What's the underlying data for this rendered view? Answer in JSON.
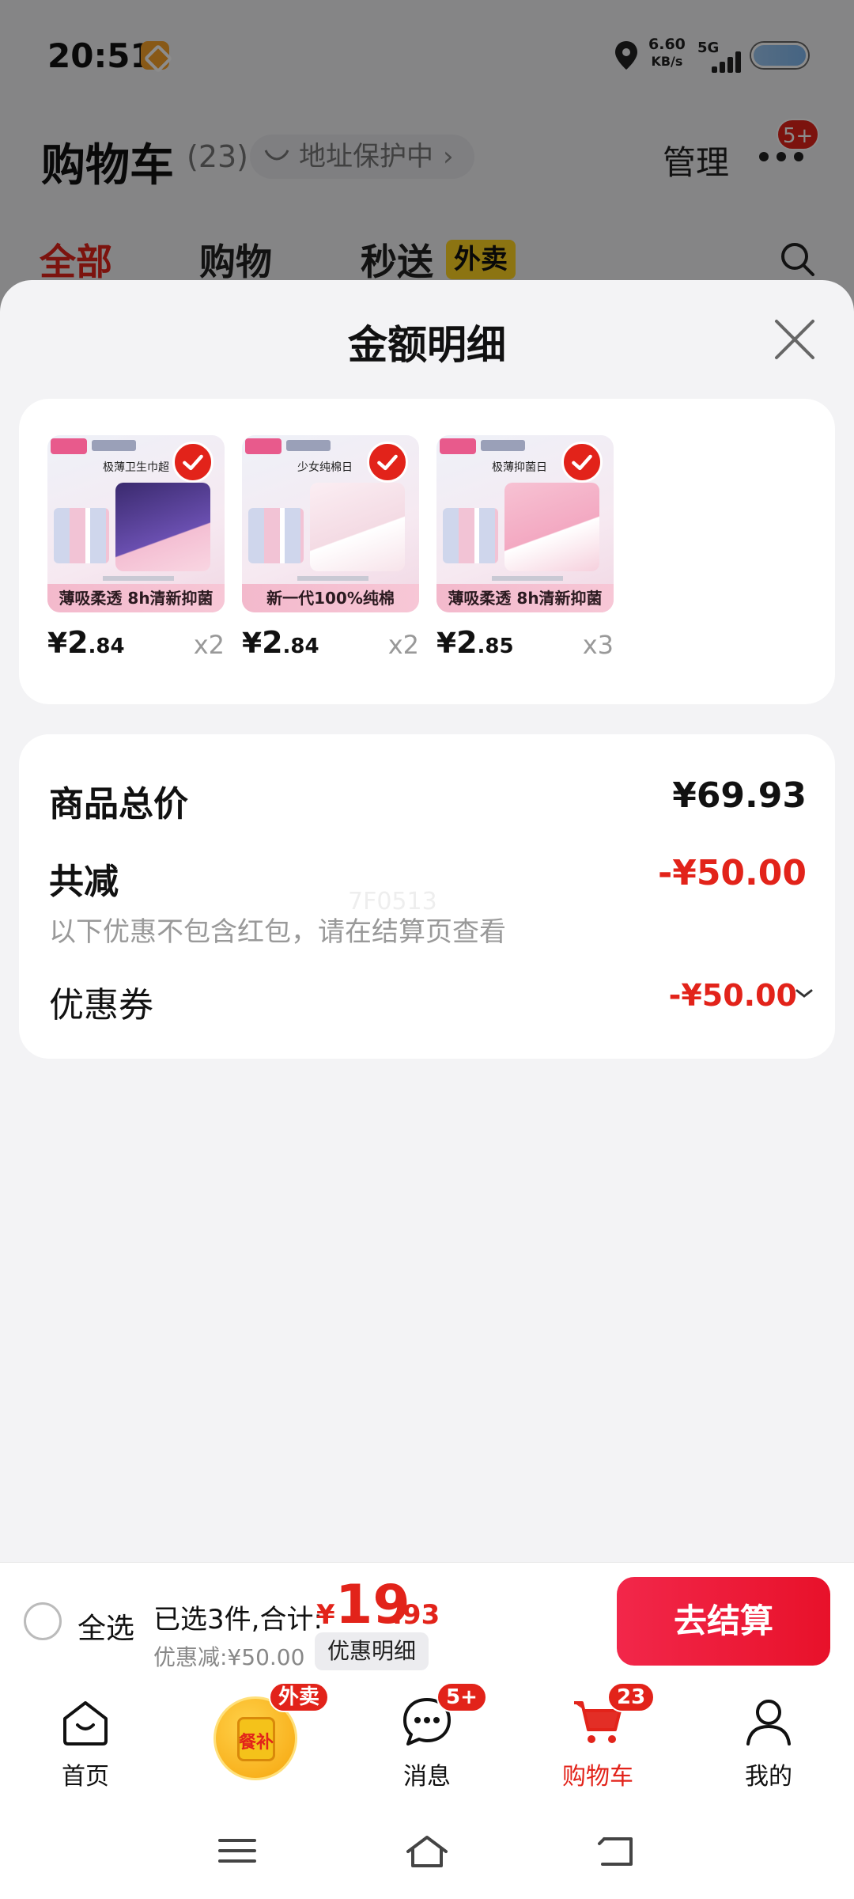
{
  "status_bar": {
    "time": "20:51",
    "net_speed_value": "6.60",
    "net_speed_unit": "KB/s",
    "network_type": "5G",
    "icons": [
      "app-notification-icon",
      "location-icon",
      "signal-icon",
      "battery-icon"
    ]
  },
  "header": {
    "title": "购物车",
    "count": "(23)",
    "address_protect": "地址保护中",
    "manage": "管理",
    "more_badge": "5+"
  },
  "tabs": [
    {
      "label": "全部",
      "active": true
    },
    {
      "label": "购物",
      "active": false
    },
    {
      "label": "秒送",
      "active": false,
      "tag": "外卖"
    }
  ],
  "sheet": {
    "title": "金额明细",
    "products": [
      {
        "price_yen": "¥",
        "price_int": "2",
        "price_dec": ".84",
        "qty": "x2",
        "banner": "薄吸柔透 8h清新抑菌",
        "headline": "极薄卫生巾超",
        "box_color": "#3a2a6e"
      },
      {
        "price_yen": "¥",
        "price_int": "2",
        "price_dec": ".84",
        "qty": "x2",
        "banner": "新一代100%纯棉",
        "headline": "少女纯棉日",
        "box_color": "#f4dbe4"
      },
      {
        "price_yen": "¥",
        "price_int": "2",
        "price_dec": ".85",
        "qty": "x3",
        "banner": "薄吸柔透 8h清新抑菌",
        "headline": "极薄抑菌日",
        "box_color": "#f3a9c2"
      }
    ],
    "summary": {
      "total_label": "商品总价",
      "total_value": "¥69.93",
      "reduce_label": "共减",
      "reduce_value": "-¥50.00",
      "note": "以下优惠不包含红包，请在结算页查看",
      "coupon_label": "优惠券",
      "coupon_value": "-¥50.00",
      "watermark": "7F0513"
    }
  },
  "checkout": {
    "select_all": "全选",
    "selected_summary": "已选3件,合计:",
    "total_yen": "¥",
    "total_int": "19",
    "total_dec": ".93",
    "discount": "优惠减:¥50.00",
    "detail_button": "优惠明细",
    "checkout_button": "去结算"
  },
  "tabbar": [
    {
      "label": "首页",
      "icon": "home-icon"
    },
    {
      "label": "",
      "icon": "meal-subsidy-icon",
      "badge": "外卖",
      "center_text": "餐补"
    },
    {
      "label": "消息",
      "icon": "message-icon",
      "badge": "5+"
    },
    {
      "label": "购物车",
      "icon": "cart-icon",
      "badge": "23",
      "active": true
    },
    {
      "label": "我的",
      "icon": "profile-icon"
    }
  ],
  "colors": {
    "accent_red": "#e2231a",
    "tag_yellow": "#ffd321",
    "checkout_red": "#f2274a",
    "sheet_bg": "#f3f3f5"
  }
}
